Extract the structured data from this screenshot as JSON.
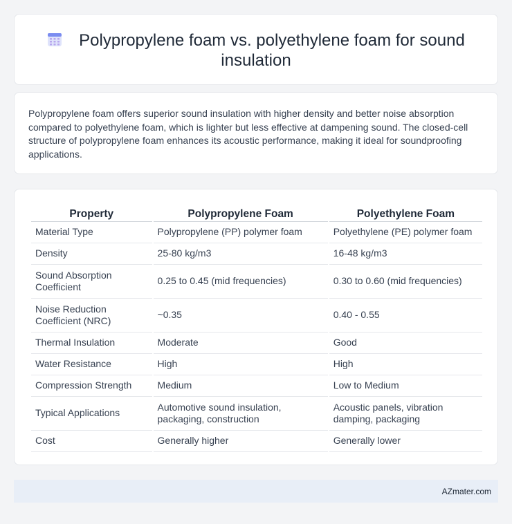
{
  "header": {
    "title": "Polypropylene foam vs. polyethylene foam for sound insulation",
    "icon": "calendar-grid-icon",
    "icon_colors": {
      "top": "#7b8cf0",
      "body": "#dfe3fb",
      "dots": "#b7a6ee"
    }
  },
  "summary": {
    "text": "Polypropylene foam offers superior sound insulation with higher density and better noise absorption compared to polyethylene foam, which is lighter but less effective at dampening sound. The closed-cell structure of polypropylene foam enhances its acoustic performance, making it ideal for soundproofing applications."
  },
  "table": {
    "headers": [
      "Property",
      "Polypropylene Foam",
      "Polyethylene Foam"
    ],
    "rows": [
      [
        "Material Type",
        "Polypropylene (PP) polymer foam",
        "Polyethylene (PE) polymer foam"
      ],
      [
        "Density",
        "25-80 kg/m3",
        "16-48 kg/m3"
      ],
      [
        "Sound Absorption Coefficient",
        "0.25 to 0.45 (mid frequencies)",
        "0.30 to 0.60 (mid frequencies)"
      ],
      [
        "Noise Reduction Coefficient (NRC)",
        "~0.35",
        "0.40 - 0.55"
      ],
      [
        "Thermal Insulation",
        "Moderate",
        "Good"
      ],
      [
        "Water Resistance",
        "High",
        "High"
      ],
      [
        "Compression Strength",
        "Medium",
        "Low to Medium"
      ],
      [
        "Typical Applications",
        "Automotive sound insulation, packaging, construction",
        "Acoustic panels, vibration damping, packaging"
      ],
      [
        "Cost",
        "Generally higher",
        "Generally lower"
      ]
    ]
  },
  "footer": {
    "brand": "AZmater.com"
  }
}
